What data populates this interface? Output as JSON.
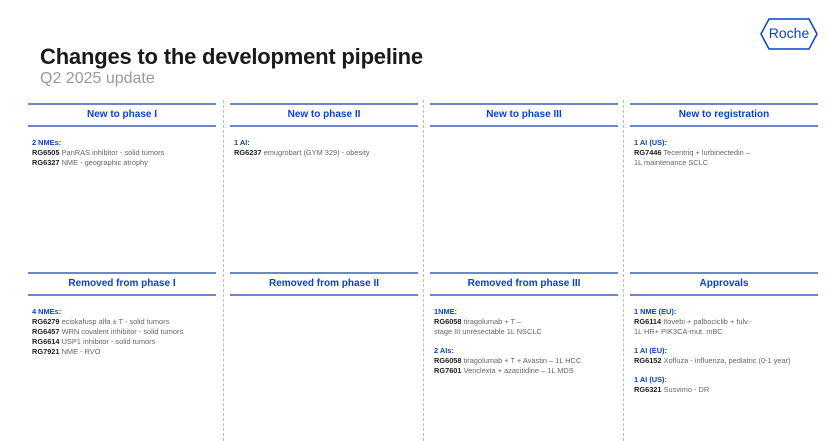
{
  "header": {
    "title": "Changes to the development pipeline",
    "subtitle": "Q2 2025 update",
    "logo": "Roche"
  },
  "sections": [
    {
      "title": "New to phase I",
      "groups": [
        {
          "label": "2 NMEs:",
          "items": [
            {
              "code": "RG6505",
              "text": "PanRAS inhibitor - solid tumors"
            },
            {
              "code": "RG6327",
              "text": "NME -  geographic atrophy"
            }
          ]
        }
      ]
    },
    {
      "title": "New to phase II",
      "groups": [
        {
          "label": "1 AI:",
          "items": [
            {
              "code": "RG6237",
              "text": "emugrobart (GYM 329) - obesity"
            }
          ]
        }
      ]
    },
    {
      "title": "New to phase III",
      "groups": []
    },
    {
      "title": "New to registration",
      "groups": [
        {
          "label": "1 AI (US):",
          "items": [
            {
              "code": "RG7446",
              "text": "Tecentriq + lurbinectedin –",
              "text2": "1L maintenance SCLC"
            }
          ]
        }
      ]
    },
    {
      "title": "Removed from phase I",
      "groups": [
        {
          "label": "4 NMEs:",
          "items": [
            {
              "code": "RG6279",
              "text": "eciskafusp alfa ± T - solid tumors"
            },
            {
              "code": "RG6457",
              "text": "WRN covalent inhibitor - solid tumors"
            },
            {
              "code": "RG6614",
              "text": "USP1 inhibitor - solid tumors"
            },
            {
              "code": "RG7921",
              "text": "NME - RVO"
            }
          ]
        }
      ]
    },
    {
      "title": "Removed from phase II",
      "groups": []
    },
    {
      "title": "Removed from phase III",
      "groups": [
        {
          "label": "1NME:",
          "items": [
            {
              "code": "RG6058",
              "text": "tiragolumab + T –",
              "text2": "stage III unresectable 1L NSCLC"
            }
          ]
        },
        {
          "label": "2 AIs:",
          "items": [
            {
              "code": "RG6058",
              "text": "tiragolumab + T + Avastin – 1L HCC"
            },
            {
              "code": "RG7601",
              "text": "Venclexta + azacitidine – 1L MDS"
            }
          ]
        }
      ]
    },
    {
      "title": "Approvals",
      "groups": [
        {
          "label": "1 NME (EU):",
          "items": [
            {
              "code": "RG6114",
              "text": "Itovebi + palbociclib + fulv.-",
              "text2": "1L HR+ PIK3CA-mut. mBC"
            }
          ]
        },
        {
          "label": "1 AI (EU):",
          "items": [
            {
              "code": "RG6152",
              "text": "Xofluza - influenza, pediatric (0-1 year)"
            }
          ]
        },
        {
          "label": "1 AI (US):",
          "items": [
            {
              "code": "RG6321",
              "text": "Susvimo - DR"
            }
          ]
        }
      ]
    }
  ],
  "colors": {
    "accent": "#0b41cd",
    "rule": "#6d86c7"
  }
}
